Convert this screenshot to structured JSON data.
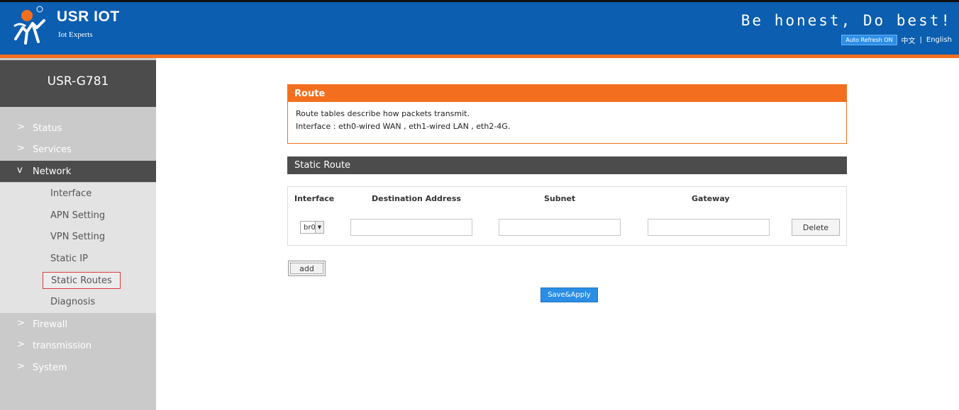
{
  "header": {
    "brand": "USR IOT",
    "brand_sub": "Iot Experts",
    "slogan": "Be honest, Do best!",
    "auto_refresh": "Auto Refresh ON",
    "lang_zh": "中文",
    "lang_sep": "|",
    "lang_en": "English",
    "colors": {
      "header_bg": "#0b5eb0",
      "accent": "#f36f1f"
    }
  },
  "sidebar": {
    "model": "USR-G781",
    "items": [
      {
        "label": "Status",
        "chevron": ">"
      },
      {
        "label": "Services",
        "chevron": ">"
      },
      {
        "label": "Network",
        "chevron": "v",
        "expanded": true
      },
      {
        "label": "Firewall",
        "chevron": ">"
      },
      {
        "label": "transmission",
        "chevron": ">"
      },
      {
        "label": "System",
        "chevron": ">"
      }
    ],
    "network_sub": [
      {
        "label": "Interface"
      },
      {
        "label": "APN Setting"
      },
      {
        "label": "VPN Setting"
      },
      {
        "label": "Static IP"
      },
      {
        "label": "Static Routes",
        "selected": true
      },
      {
        "label": "Diagnosis"
      }
    ]
  },
  "route": {
    "title": "Route",
    "line1": "Route tables describe how packets transmit.",
    "line2": "Interface : eth0-wired WAN , eth1-wired LAN , eth2-4G."
  },
  "static_route": {
    "title": "Static Route",
    "columns": [
      "Interface",
      "Destination Address",
      "Subnet",
      "Gateway"
    ],
    "row": {
      "interface": "br0",
      "destination": "",
      "subnet": "",
      "gateway": "",
      "delete_label": "Delete"
    }
  },
  "actions": {
    "add_label": "add",
    "save_label": "Save&Apply"
  }
}
